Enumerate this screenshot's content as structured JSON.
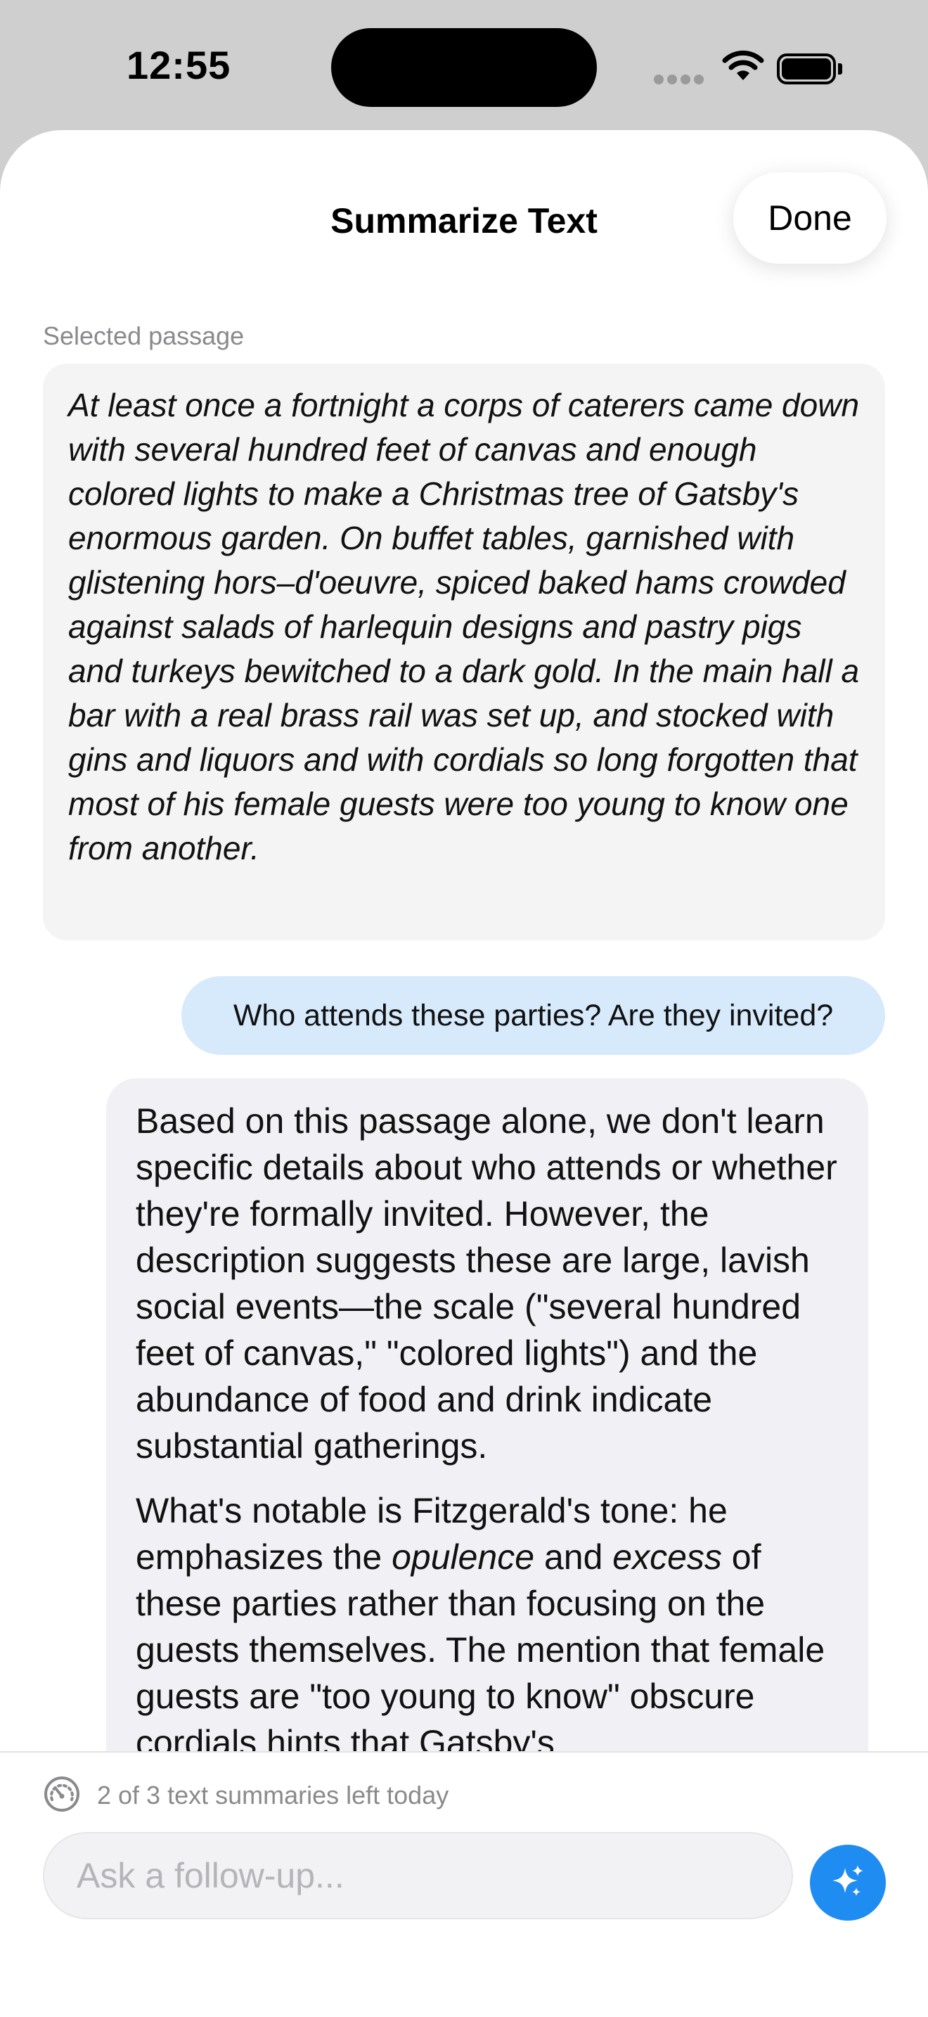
{
  "status_bar": {
    "time": "12:55"
  },
  "sheet": {
    "title": "Summarize Text",
    "done_label": "Done"
  },
  "passage": {
    "label": "Selected passage",
    "text": "At least once a fortnight a corps of caterers came down with several hundred feet of canvas and enough colored lights to make a Christmas tree of Gatsby's enormous garden. On buffet tables, garnished with glistening hors–d'oeuvre, spiced baked hams crowded against salads of harlequin designs and pastry pigs and turkeys bewitched to a dark gold. In the main hall a bar with a real brass rail was set up, and stocked with gins and liquors and with cordials so long forgotten that most of his female guests were too young to know one from another."
  },
  "user_message": "Who attends these parties? Are they invited?",
  "assistant_reply": {
    "paragraph1": "Based on this passage alone, we don't learn specific details about who attends or whether they're formally invited. However, the description suggests these are large, lavish social events—the scale (\"several hundred feet of canvas,\" \"colored lights\") and the abundance of food and drink indicate substantial gatherings.",
    "paragraph2_part1": "What's notable is Fitzgerald's tone: he emphasizes the ",
    "paragraph2_em1": "opulence",
    "paragraph2_part2": " and ",
    "paragraph2_em2": "excess",
    "paragraph2_part3": " of these parties rather than focusing on the guests themselves. The mention that female guests are \"too young to know\" obscure cordials hints that Gatsby's"
  },
  "footer": {
    "limit_text": "2 of 3 text summaries left today",
    "input_placeholder": "Ask a follow-up...",
    "input_value": ""
  },
  "colors": {
    "accent": "#1f8cf2",
    "user_bubble": "#d6eafc",
    "card_background": "#f4f4f4",
    "secondary_text": "#8a8a8e"
  },
  "icons": {
    "limit": "gauge-icon",
    "send": "sparkles-icon"
  }
}
